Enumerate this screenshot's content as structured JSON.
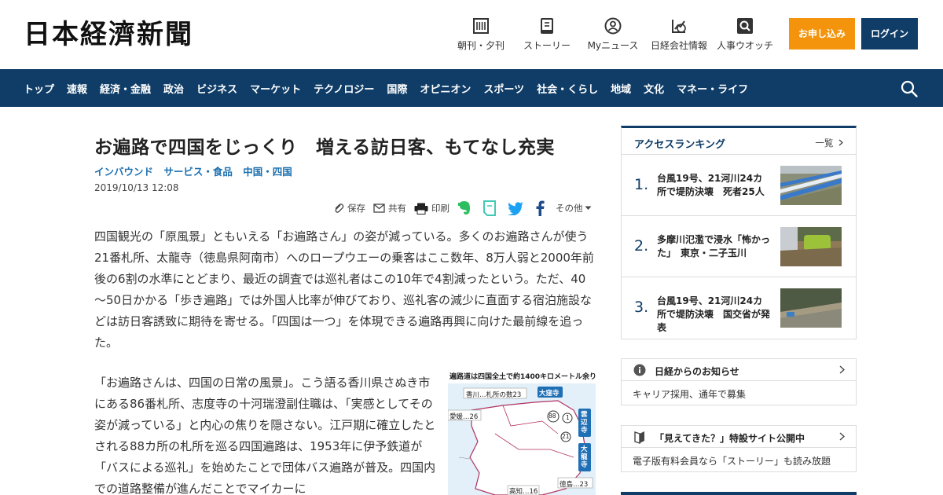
{
  "header": {
    "logo_text": "日本経濟新聞",
    "nav": [
      {
        "label": "朝刊・夕刊",
        "icon": "newspaper-icon"
      },
      {
        "label": "ストーリー",
        "icon": "book-icon"
      },
      {
        "label": "Myニュース",
        "icon": "person-icon"
      },
      {
        "label": "日経会社情報",
        "icon": "chart-icon"
      },
      {
        "label": "人事ウオッチ",
        "icon": "search-person-icon"
      }
    ],
    "apply_label": "お申し込み",
    "login_label": "ログイン"
  },
  "navbar": {
    "items": [
      "トップ",
      "速報",
      "経済・金融",
      "政治",
      "ビジネス",
      "マーケット",
      "テクノロジー",
      "国際",
      "オピニオン",
      "スポーツ",
      "社会・くらし",
      "地域",
      "文化",
      "マネー・ライフ"
    ],
    "search_icon": "search-icon"
  },
  "article": {
    "title": "お遍路で四国をじっくり　増える訪日客、もてなし充実",
    "tags": [
      "インバウンド",
      "サービス・食品",
      "中国・四国"
    ],
    "date": "2019/10/13 12:08",
    "tools": {
      "save": "保存",
      "share": "共有",
      "print": "印刷",
      "more": "その他"
    },
    "lead": "四国観光の「原風景」ともいえる「お遍路さん」の姿が減っている。多くのお遍路さんが使う21番札所、太龍寺（徳島県阿南市）へのロープウエーの乗客はここ数年、8万人弱と2000年前後の6割の水準にとどまり、最近の調査では巡礼者はこの10年で4割減ったという。ただ、40～50日かかる「歩き遍路」では外国人比率が伸びており、巡礼客の減少に直面する宿泊施設などは訪日客誘致に期待を寄せる。「四国は一つ」を体現できる遍路再興に向けた最前線を追った。",
    "body": "「お遍路さんは、四国の日常の風景」。こう語る香川県さぬき市にある86番札所、志度寺の十河瑞澄副住職は、「実感としてその姿が減っている」と内心の焦りを隠さない。江戸期に確立したとされる88カ所の札所を巡る四国遍路は、1953年に伊予鉄道が「バスによる巡礼」を始めたことで団体バス遍路が普及。四国内での道路整備が進んだことでマイカーに",
    "figure": {
      "caption": "遍路道は四国全土で約1400キロメートル余り",
      "labels": {
        "kagawa": "香川…札所の数23",
        "ehime": "愛媛…26",
        "kochi": "高知…16",
        "tokushima": "徳島…23",
        "temple1": "大窪寺",
        "temple2": "雲辺寺",
        "temple3": "大龍寺",
        "num88": "88",
        "num1": "1",
        "num21": "21"
      }
    }
  },
  "sidebar": {
    "ranking": {
      "title": "アクセスランキング",
      "more": "一覧",
      "items": [
        {
          "num": "1.",
          "text": "台風19号、21河川24カ所で堤防決壊　死者25人"
        },
        {
          "num": "2.",
          "text": "多摩川氾濫で浸水「怖かった」　東京・二子玉川"
        },
        {
          "num": "3.",
          "text": "台風19号、21河川24カ所で堤防決壊　国交省が発表"
        }
      ]
    },
    "notice1": {
      "title": "日経からのお知らせ",
      "body": "キャリア採用、通年で募集"
    },
    "notice2": {
      "title": "「見えてきた？」特設サイト公開中",
      "body": "電子版有料会員なら「ストーリー」も読み放題"
    }
  },
  "colors": {
    "brand_navy": "#0f3d67",
    "apply_orange": "#f4930c",
    "tag_blue": "#1b6fb0"
  }
}
